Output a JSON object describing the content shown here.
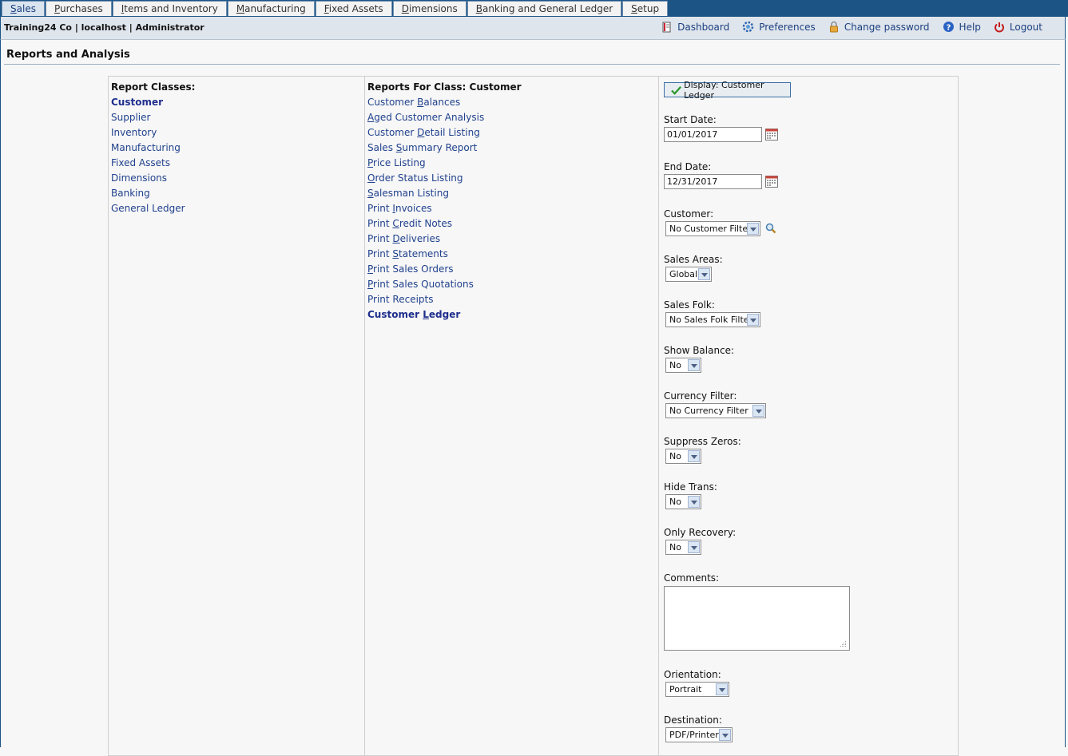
{
  "tabs": [
    {
      "pre": "",
      "key": "S",
      "post": "ales"
    },
    {
      "pre": "",
      "key": "P",
      "post": "urchases"
    },
    {
      "pre": "",
      "key": "I",
      "post": "tems and Inventory"
    },
    {
      "pre": "",
      "key": "M",
      "post": "anufacturing"
    },
    {
      "pre": "",
      "key": "F",
      "post": "ixed Assets"
    },
    {
      "pre": "",
      "key": "D",
      "post": "imensions"
    },
    {
      "pre": "",
      "key": "B",
      "post": "anking and General Ledger"
    },
    {
      "pre": "",
      "key": "S",
      "post": "etup"
    }
  ],
  "header": {
    "company": "Training24 Co | localhost | Administrator",
    "links": {
      "dashboard": "Dashboard",
      "preferences": "Preferences",
      "change_password": "Change password",
      "help": "Help",
      "logout": "Logout"
    }
  },
  "page": {
    "title": "Reports and Analysis"
  },
  "classes": {
    "heading": "Report Classes:",
    "items": [
      "Customer",
      "Supplier",
      "Inventory",
      "Manufacturing",
      "Fixed Assets",
      "Dimensions",
      "Banking",
      "General Ledger"
    ]
  },
  "reports": {
    "heading": "Reports For Class:  Customer",
    "items": [
      {
        "pre": "Customer ",
        "key": "B",
        "post": "alances"
      },
      {
        "pre": "",
        "key": "A",
        "post": "ged Customer Analysis"
      },
      {
        "pre": "Customer ",
        "key": "D",
        "post": "etail Listing"
      },
      {
        "pre": "Sales ",
        "key": "S",
        "post": "ummary Report"
      },
      {
        "pre": "",
        "key": "P",
        "post": "rice Listing"
      },
      {
        "pre": "",
        "key": "O",
        "post": "rder Status Listing"
      },
      {
        "pre": "",
        "key": "S",
        "post": "alesman Listing"
      },
      {
        "pre": "Print ",
        "key": "I",
        "post": "nvoices"
      },
      {
        "pre": "Print ",
        "key": "C",
        "post": "redit Notes"
      },
      {
        "pre": "Print ",
        "key": "D",
        "post": "eliveries"
      },
      {
        "pre": "Print ",
        "key": "S",
        "post": "tatements"
      },
      {
        "pre": "",
        "key": "P",
        "post": "rint Sales Orders"
      },
      {
        "pre": "",
        "key": "P",
        "post": "rint Sales Quotations"
      },
      {
        "pre": "Print Receipts",
        "key": "",
        "post": ""
      },
      {
        "pre": "Customer ",
        "key": "L",
        "post": "edger"
      }
    ]
  },
  "form": {
    "display_button": "Display: Customer Ledger",
    "start_date_label": "Start Date:",
    "start_date": "01/01/2017",
    "end_date_label": "End Date:",
    "end_date": "12/31/2017",
    "customer_label": "Customer:",
    "customer": "No Customer Filter",
    "sales_areas_label": "Sales Areas:",
    "sales_areas": "Global",
    "sales_folk_label": "Sales Folk:",
    "sales_folk": "No Sales Folk Filter",
    "show_balance_label": "Show Balance:",
    "show_balance": "No",
    "currency_filter_label": "Currency Filter:",
    "currency_filter": "No Currency Filter",
    "suppress_zeros_label": "Suppress Zeros:",
    "suppress_zeros": "No",
    "hide_trans_label": "Hide Trans:",
    "hide_trans": "No",
    "only_recovery_label": "Only Recovery:",
    "only_recovery": "No",
    "comments_label": "Comments:",
    "comments": "",
    "orientation_label": "Orientation:",
    "orientation": "Portrait",
    "destination_label": "Destination:",
    "destination": "PDF/Printer"
  }
}
